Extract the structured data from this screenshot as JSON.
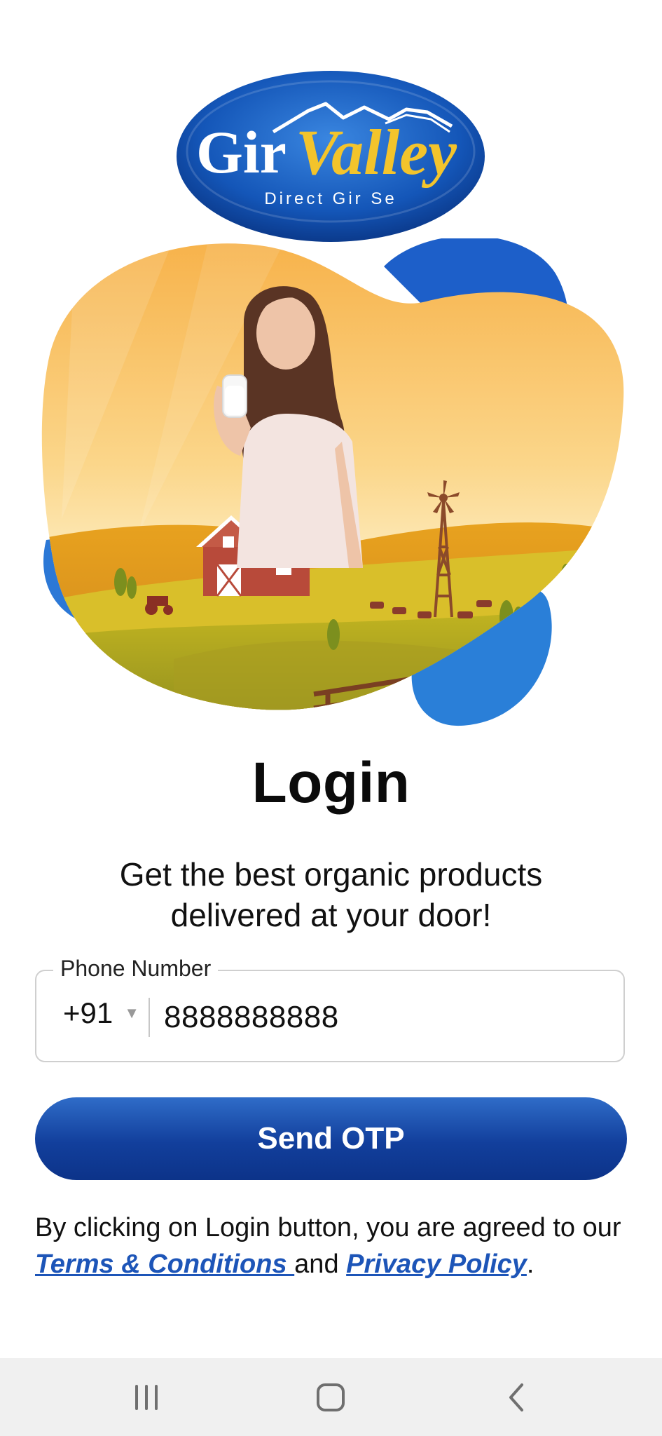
{
  "logo": {
    "brand_left": "Gir",
    "brand_right": "Valley",
    "tagline": "Direct Gir Se",
    "colors": {
      "oval": "#1a5fc4",
      "gir": "#ffffff",
      "valley": "#f3c42c"
    }
  },
  "hero": {
    "icon": "woman-drinking-milk-farm-illustration"
  },
  "login": {
    "title": "Login",
    "subtitle_line1": "Get the best organic products",
    "subtitle_line2": "delivered at your door!"
  },
  "phone": {
    "label": "Phone Number",
    "country_code": "+91",
    "value": "8888888888"
  },
  "send_otp_label": "Send OTP",
  "terms": {
    "prefix": "By clicking on Login button, you are agreed to our ",
    "terms_link": "Terms & Conditions ",
    "middle": "and ",
    "privacy_link": "Privacy Policy",
    "suffix": "."
  },
  "navbar": {
    "recents_icon": "recents-icon",
    "home_icon": "home-icon",
    "back_icon": "back-icon"
  },
  "colors": {
    "primary": "#1d55b8",
    "button_top": "#2f6cc8",
    "button_bottom": "#0c3389",
    "hero_blue": "#1d5fc9",
    "hero_orange": "#f6b14a"
  }
}
